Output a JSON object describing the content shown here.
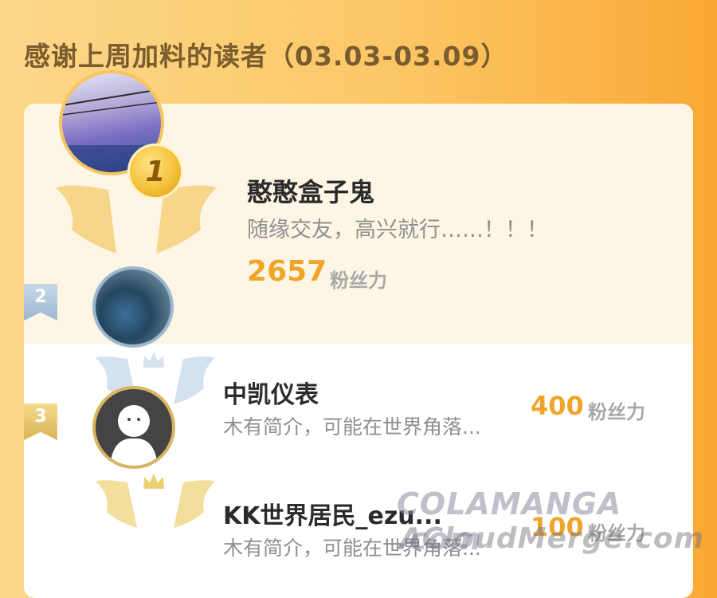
{
  "header": {
    "title": "感谢上周加料的读者（03.03-03.09）"
  },
  "ranking": [
    {
      "rank": "1",
      "name": "憨憨盒子鬼",
      "bio": "随缘交友，高兴就行……！！！",
      "score": "2657",
      "unit": "粉丝力"
    },
    {
      "rank": "2",
      "name": "中凯仪表",
      "bio": "木有简介，可能在世界角落...",
      "score": "400",
      "unit": "粉丝力"
    },
    {
      "rank": "3",
      "name": "KK世界居民_ezu...",
      "bio": "木有简介，可能在世界角落...",
      "score": "100",
      "unit": "粉丝力"
    }
  ],
  "watermark": {
    "line1": "COLAMANGA .com",
    "line2": "ACloudMerge.com"
  },
  "colors": {
    "accent": "#f0a52a",
    "gold": "#f6c55e",
    "silver": "#9fb6cf",
    "bronze": "#d8b560"
  }
}
